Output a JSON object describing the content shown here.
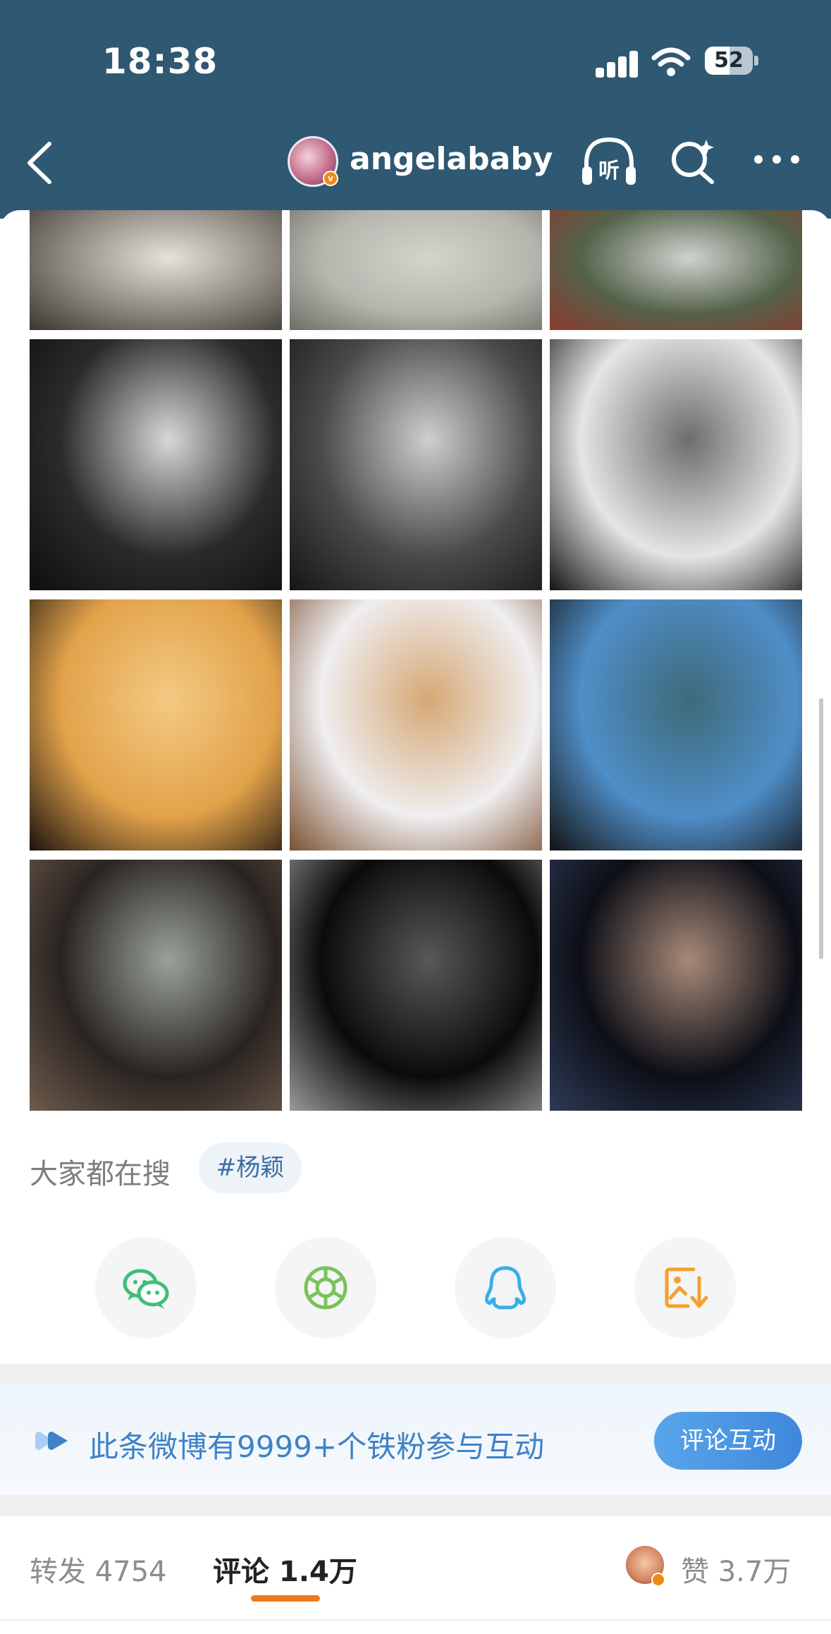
{
  "status_bar": {
    "time": "18:38",
    "battery": "52",
    "battery_level": 0.52
  },
  "header": {
    "username": "angelababy",
    "listen_label": "听"
  },
  "photos": [
    {
      "name": "photo-cafe-table",
      "colors": [
        "#8a857d",
        "#e6e2db",
        "#3a3530"
      ]
    },
    {
      "name": "photo-park-walk",
      "colors": [
        "#b4b6ae",
        "#d4d3cc",
        "#6d6e66"
      ]
    },
    {
      "name": "photo-restaurant-bottles",
      "colors": [
        "#55624a",
        "#cfd3cf",
        "#8a3a2f"
      ]
    },
    {
      "name": "photo-bw-portrait-ruffle",
      "colors": [
        "#2b2b2b",
        "#d8d8d8",
        "#0e0e0e"
      ]
    },
    {
      "name": "photo-bw-bookstall",
      "colors": [
        "#4a4a4a",
        "#cfcfcf",
        "#151515"
      ]
    },
    {
      "name": "photo-bw-graffiti-wall",
      "colors": [
        "#e5e5e5",
        "#6d6d6d",
        "#141414"
      ]
    },
    {
      "name": "photo-black-gown-amber",
      "colors": [
        "#e2a24a",
        "#f3c982",
        "#1a120e"
      ]
    },
    {
      "name": "photo-closeup-portrait",
      "colors": [
        "#efeef0",
        "#d6a875",
        "#7b5030"
      ]
    },
    {
      "name": "photo-river-fan",
      "colors": [
        "#4f8ec8",
        "#3e6a79",
        "#121212"
      ]
    },
    {
      "name": "photo-stairs-event",
      "colors": [
        "#2a2421",
        "#9aa29c",
        "#6d5b4c"
      ]
    },
    {
      "name": "photo-stage-spotlight",
      "colors": [
        "#0b0b0b",
        "#585858",
        "#9a9a9a"
      ]
    },
    {
      "name": "photo-closeup-eyes",
      "colors": [
        "#0d0f17",
        "#a88a78",
        "#2d3a55"
      ]
    }
  ],
  "search": {
    "label": "大家都在搜",
    "tag": "#杨颖"
  },
  "share": [
    {
      "name": "wechat-share-button",
      "icon": "wechat-icon",
      "color": "#3fbe7a"
    },
    {
      "name": "moments-share-button",
      "icon": "moments-icon",
      "color": "#7bc25a"
    },
    {
      "name": "qq-share-button",
      "icon": "qq-icon",
      "color": "#3aaee8"
    },
    {
      "name": "save-image-button",
      "icon": "save-image-icon",
      "color": "#f3a12c"
    }
  ],
  "fans_banner": {
    "text": "此条微博有9999+个铁粉参与互动",
    "button": "评论互动"
  },
  "tabs": {
    "repost": "转发 4754",
    "comment": "评论 1.4万",
    "like": "赞 3.7万"
  },
  "colors": {
    "header_bg": "#2f5872",
    "accent_blue": "#3f82c6",
    "tab_underline": "#f07a1a"
  }
}
